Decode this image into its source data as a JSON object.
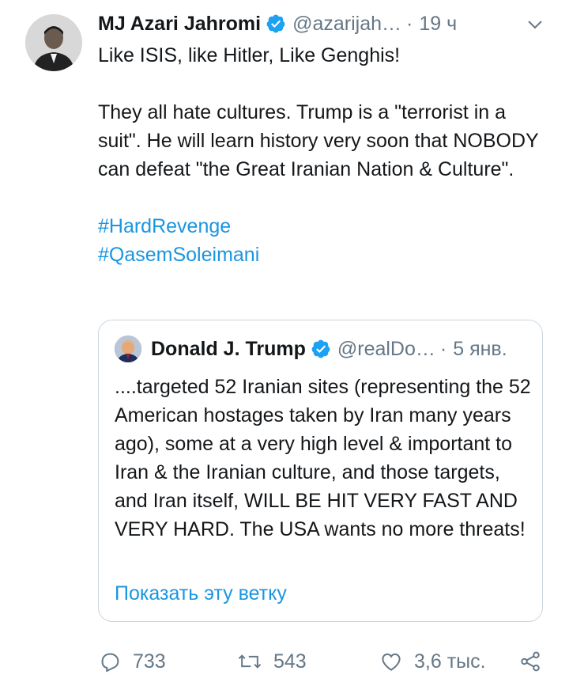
{
  "tweet": {
    "author": {
      "name": "MJ Azari Jahromi",
      "handle": "@azarijah…",
      "time": "19 ч"
    },
    "lines": [
      "Like ISIS, like Hitler, Like Genghis!",
      "They all hate cultures. Trump is a \"terrorist in a suit\". He will learn history very soon that NOBODY can defeat \"the Great Iranian Nation & Culture\"."
    ],
    "hashtags": [
      "#HardRevenge",
      "#QasemSoleimani"
    ],
    "separator": "·"
  },
  "quoted": {
    "author": {
      "name": "Donald J. Trump",
      "handle": "@realDo…",
      "time": "5 янв."
    },
    "text": "....targeted 52 Iranian sites (representing the 52 American hostages taken by Iran many years ago), some at a very high level & important to Iran &  the Iranian culture, and those targets, and Iran itself, WILL BE HIT VERY FAST AND VERY HARD. The USA wants no more threats!",
    "show_thread": "Показать эту ветку"
  },
  "actions": {
    "replies": "733",
    "retweets": "543",
    "likes": "3,6 тыс."
  },
  "icons": {
    "verified": "verified-badge-icon",
    "caret": "chevron-down-icon",
    "reply": "reply-icon",
    "retweet": "retweet-icon",
    "like": "heart-icon",
    "share": "share-icon"
  },
  "colors": {
    "link": "#1b95e0",
    "muted": "#657786",
    "text": "#14171a",
    "border": "#ccd6dd"
  }
}
